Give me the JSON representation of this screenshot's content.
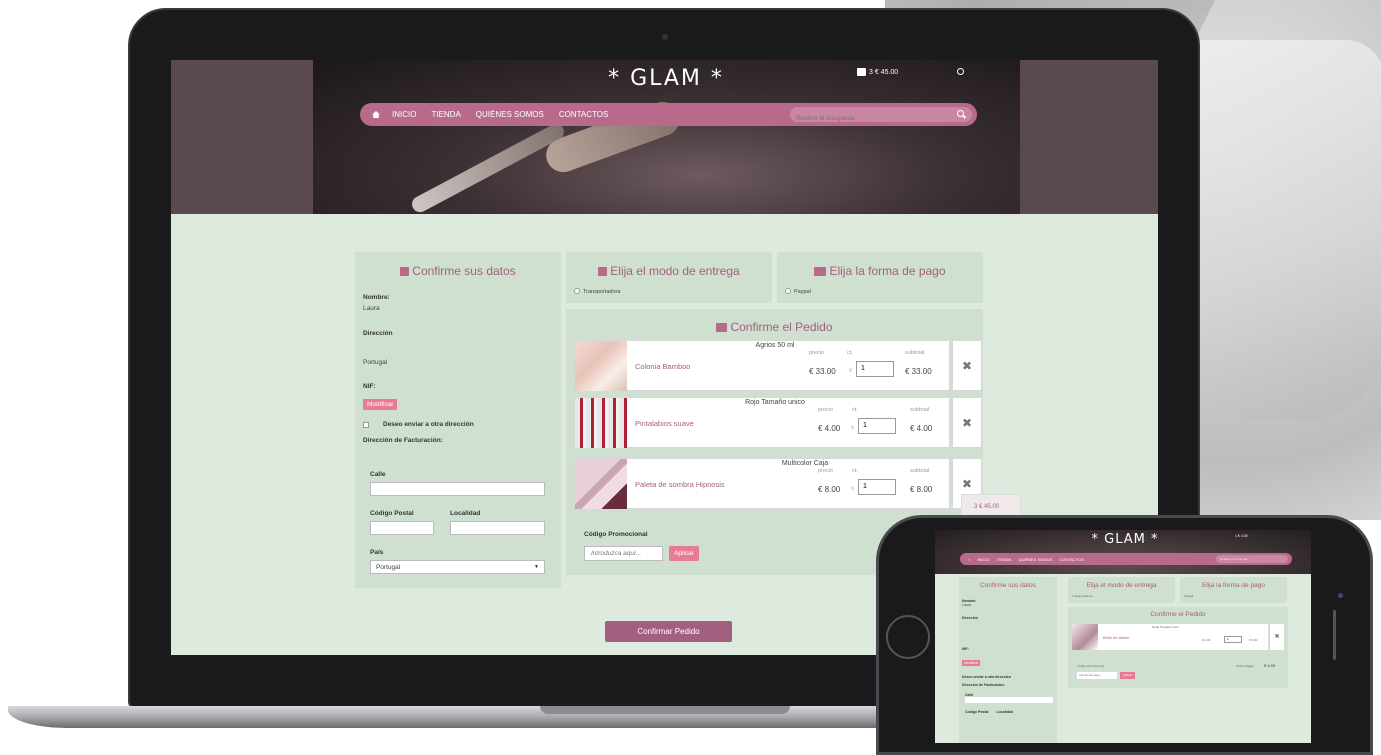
{
  "header": {
    "logo": "* GLAM *",
    "cart_summary": "3 € 45.00",
    "nav": [
      "INICIO",
      "TIENDA",
      "QUIÉNES SOMOS",
      "CONTACTOS"
    ],
    "search_placeholder": "Realice la búsqueda"
  },
  "datos": {
    "title": "Confirme sus datos",
    "nombre_label": "Nombre:",
    "nombre_value": "Laura",
    "direccion_label": "Dirección",
    "direccion_value": "Portugal",
    "nif_label": "NIF:",
    "modificar": "Modificar",
    "otra_direccion": "Deseo enviar a otra dirección",
    "facturacion_label": "Dirección de Facturación:",
    "calle_label": "Calle",
    "cp_label": "Código Postal",
    "localidad_label": "Localidad",
    "pais_label": "País",
    "pais_value": "Portugal"
  },
  "entrega": {
    "title": "Elija el modo de entrega",
    "option": "Transportadora"
  },
  "pago": {
    "title": "Elija la forma de pago",
    "option": "Paypal"
  },
  "pedido": {
    "title": "Confirme el Pedido",
    "col_precio": "precio",
    "col_ct": "ct.",
    "col_subtotal": "subtotal",
    "qty_x": "x",
    "items": [
      {
        "variant": "Agrios 50 ml",
        "name": "Colonia Bamboo",
        "price": "€ 33.00",
        "qty": "1",
        "subtotal": "€ 33.00"
      },
      {
        "variant": "Rojo Tamaño unico",
        "name": "Pintalabios suave",
        "price": "€ 4.00",
        "qty": "1",
        "subtotal": "€ 4.00"
      },
      {
        "variant": "Multicolor Caja",
        "name": "Paleta de sombra Hipnosis",
        "price": "€ 8.00",
        "qty": "1",
        "subtotal": "€ 8.00"
      }
    ],
    "promo_label": "Código Promocional",
    "promo_placeholder": "Introduzca aquí...",
    "aplicar": "Aplicar",
    "confirm_button": "Confirmar Pedido"
  },
  "float_cart": "3 € 45.00",
  "phone": {
    "logo": "* GLAM *",
    "cart_summary": "1 € 4.00",
    "nav": [
      "INICIO",
      "TIENDA",
      "QUIÉNES SOMOS",
      "CONTACTOS"
    ],
    "search_placeholder": "Realice la búsqueda",
    "datos_title": "Confirme sus datos",
    "nombre_label": "Nombre:",
    "nombre_value": "Laura",
    "direccion_label": "Dirección",
    "nif_label": "NIF:",
    "modificar": "Modificar",
    "otra_direccion": "Deseo enviar a otra dirección",
    "facturacion_label": "Dirección de Facturación:",
    "calle_label": "Calle",
    "cp_label": "Código Postal",
    "localidad_label": "Localidad",
    "entrega_title": "Elija el modo de entrega",
    "entrega_option": "Transportadora",
    "pago_title": "Elija la forma de pago",
    "pago_option": "Paypal",
    "pedido_title": "Confirme el Pedido",
    "item_variant": "Nude Tamaño unico",
    "item_name": "Brillo de labios",
    "item_price": "€ 4.00",
    "item_qty": "1",
    "item_subtotal": "€ 4.00",
    "promo_label": "Código Promocional",
    "promo_placeholder": "Introduzca aquí...",
    "aplicar": "Aplicar",
    "total_label": "Total a Pagar:",
    "total_value": "€ 4.00"
  },
  "colors": {
    "accent": "#b86a8b",
    "title": "#a25f7f",
    "button_pink": "#e87b94",
    "panel": "#cfe0d0",
    "page": "#dfeadf"
  }
}
